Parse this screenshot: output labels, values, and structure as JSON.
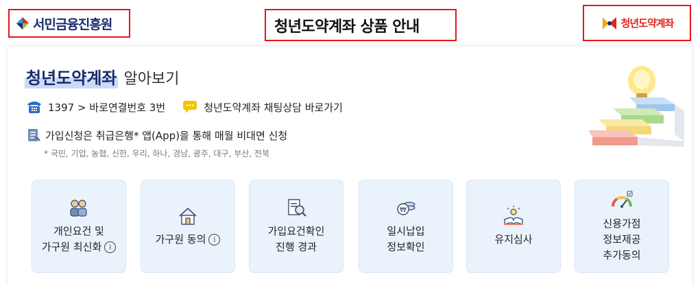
{
  "header": {
    "left_brand": "서민금융진흥원",
    "title": "청년도약계좌 상품 안내",
    "right_brand": "청년도약계좌"
  },
  "intro": {
    "heading_highlight": "청년도약계좌",
    "heading_rest": "알아보기",
    "phone_text": "1397 > 바로연결번호 3번",
    "chat_text": "청년도약계좌 채팅상담 바로가기",
    "apply_text": "가입신청은 취급은행* 앱(App)을 통해 매월 비대면 신청",
    "banks_note": "* 국민, 기업, 농협, 신한, 우리, 하나, 경남, 광주, 대구, 부산, 전북"
  },
  "cards": [
    {
      "label": "개인요건 및\n가구원 최신화",
      "has_info": true,
      "icon": "people-icon"
    },
    {
      "label": "가구원 동의",
      "has_info": true,
      "icon": "house-icon"
    },
    {
      "label": "가입요건확인\n진행 경과",
      "has_info": false,
      "icon": "document-search-icon"
    },
    {
      "label": "일시납입\n정보확인",
      "has_info": false,
      "icon": "coin-icon"
    },
    {
      "label": "유지심사",
      "has_info": false,
      "icon": "book-bulb-icon"
    },
    {
      "label": "신용가점\n정보제공\n추가동의",
      "has_info": false,
      "icon": "gauge-icon"
    }
  ],
  "colors": {
    "red_box": "#e8131b",
    "brand_navy": "#1a2a6c",
    "card_bg": "#eaf3fc",
    "highlight": "#c9dcf7"
  }
}
